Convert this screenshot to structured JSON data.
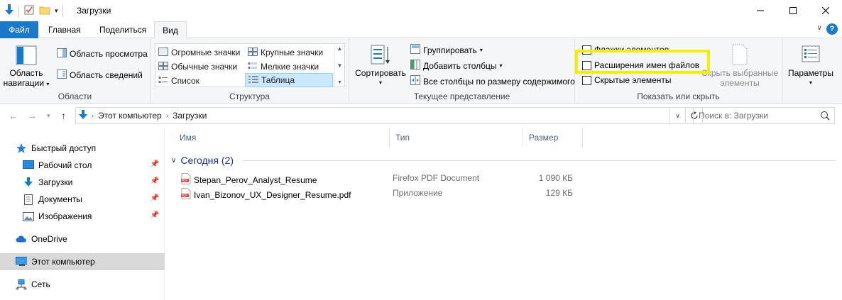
{
  "window": {
    "title": "Загрузки"
  },
  "tabs": {
    "file": "Файл",
    "home": "Главная",
    "share": "Поделиться",
    "view": "Вид"
  },
  "ribbon": {
    "panes": {
      "nav_pane_line1": "Область",
      "nav_pane_line2": "навигации",
      "preview": "Область просмотра",
      "details": "Область сведений",
      "label": "Области"
    },
    "layout": {
      "items": [
        "Огромные значки",
        "Крупные значки",
        "Обычные значки",
        "Мелкие значки",
        "Список",
        "Таблица"
      ],
      "label": "Структура"
    },
    "current_view": {
      "sort": "Сортировать",
      "group": "Группировать",
      "add_columns": "Добавить столбцы",
      "fit_columns": "Все столбцы по размеру содержимого",
      "label": "Текущее представление"
    },
    "show_hide": {
      "checkboxes": "Флажки элементов",
      "extensions": "Расширения имен файлов",
      "hidden": "Скрытые элементы",
      "hide_selected_line1": "Скрыть выбранные",
      "hide_selected_line2": "элементы",
      "label": "Показать или скрыть"
    },
    "options": {
      "label": "Параметры"
    }
  },
  "address": {
    "path": [
      "Этот компьютер",
      "Загрузки"
    ],
    "search_placeholder": "Поиск в: Загрузки"
  },
  "nav": {
    "quick_access": "Быстрый доступ",
    "desktop": "Рабочий стол",
    "downloads": "Загрузки",
    "documents": "Документы",
    "pictures": "Изображения",
    "onedrive": "OneDrive",
    "this_pc": "Этот компьютер",
    "network": "Сеть"
  },
  "content": {
    "columns": {
      "name": "Имя",
      "type": "Тип",
      "size": "Размер"
    },
    "group": "Сегодня (2)",
    "files": [
      {
        "name": "Stepan_Perov_Analyst_Resume",
        "type": "Firefox PDF Document",
        "size": "1 090 КБ"
      },
      {
        "name": "Ivan_Bizonov_UX_Designer_Resume.pdf",
        "type": "Приложение",
        "size": "129 КБ"
      }
    ]
  },
  "colors": {
    "accent": "#1979ca",
    "highlight": "#f5ee00",
    "group_text": "#1e3287"
  }
}
